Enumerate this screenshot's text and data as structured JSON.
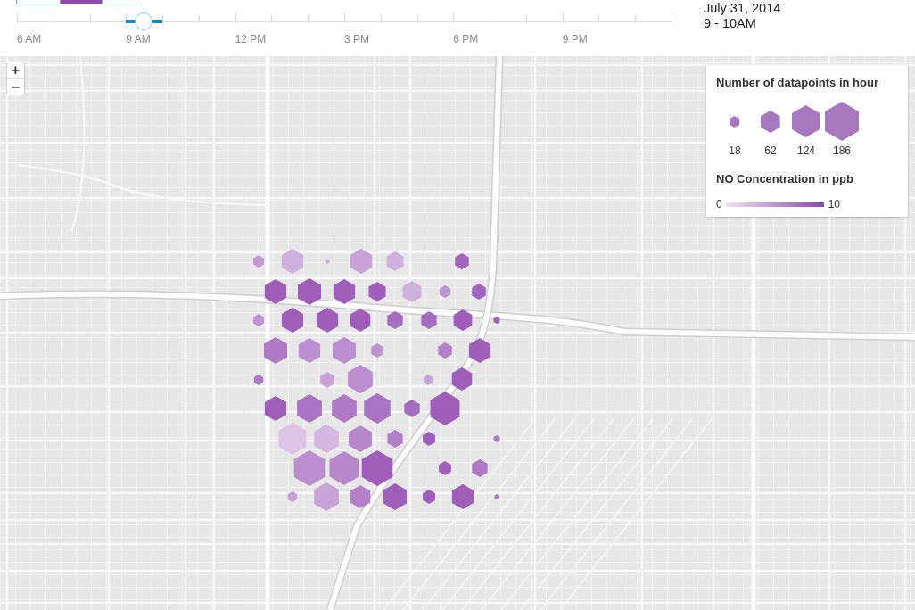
{
  "filters": [
    {
      "color": "#5aa7c9",
      "selected": false
    },
    {
      "color": "#8e4ba8",
      "selected": true
    },
    {
      "color": "#5fb98a",
      "selected": false
    }
  ],
  "time_slider": {
    "labels": [
      "6 AM",
      "9 AM",
      "12 PM",
      "3 PM",
      "6 PM",
      "9 PM"
    ],
    "level": 0.194
  },
  "date": "July 31, 2014",
  "hour_range": "9 - 10AM",
  "zoom_controls": [
    {
      "label": "+"
    },
    {
      "label": "−"
    }
  ],
  "legend": {
    "size_title": "Number of datapoints in hour",
    "size_labels": [
      "18",
      "62",
      "124",
      "186"
    ],
    "color_title": "NO Concentration in ppb",
    "color_min": "0",
    "color_max": "10"
  }
}
